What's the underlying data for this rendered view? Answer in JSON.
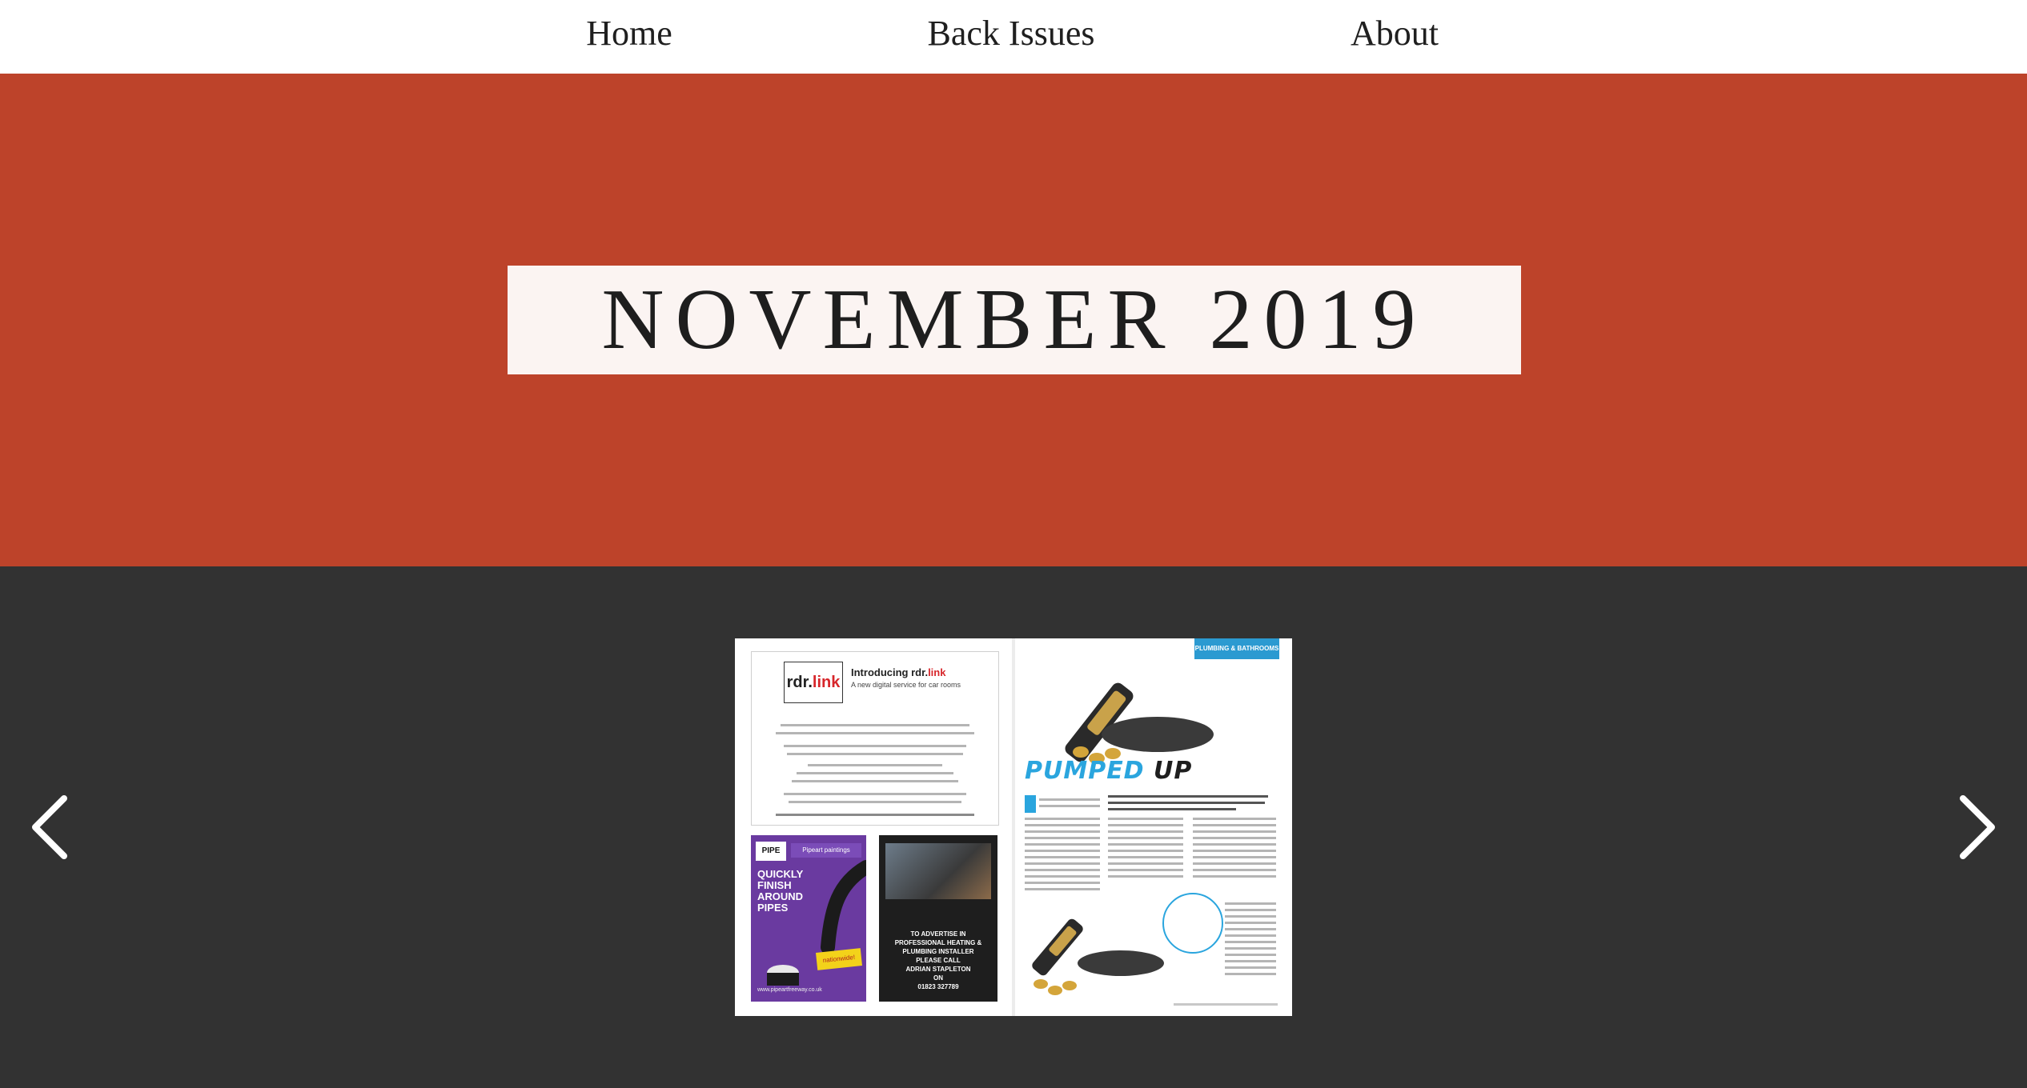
{
  "nav": {
    "items": [
      {
        "label": "Home"
      },
      {
        "label": "Back Issues"
      },
      {
        "label": "About"
      }
    ]
  },
  "hero": {
    "title": "NOVEMBER 2019",
    "background_color": "#bd432a",
    "title_box_color": "#fbf4f2"
  },
  "gallery": {
    "prev_icon": "chevron-left-icon",
    "next_icon": "chevron-right-icon",
    "background_color": "#323232",
    "spread": {
      "left_page": {
        "ad_logo_main": "rdr.",
        "ad_logo_accent": "link",
        "ad_heading_main": "Introducing rdr.",
        "ad_heading_accent": "link",
        "ad_subheading": "A new digital service for car rooms",
        "pipe_ad": {
          "logo": "PIPE",
          "tag": "Pipeart paintings",
          "headline": "QUICKLY FINISH AROUND PIPES",
          "badge": "nationwide!",
          "url": "www.pipeartfreeway.co.uk"
        },
        "advertise_box": {
          "text": "TO ADVERTISE IN\nPROFESSIONAL HEATING &\nPLUMBING INSTALLER\nPLEASE CALL\nADRIAN STAPLETON\nON\n01823 327789"
        }
      },
      "right_page": {
        "section_tag": "PLUMBING & BATHROOMS",
        "headline_main": "PUMPED",
        "headline_accent": "UP"
      }
    }
  }
}
